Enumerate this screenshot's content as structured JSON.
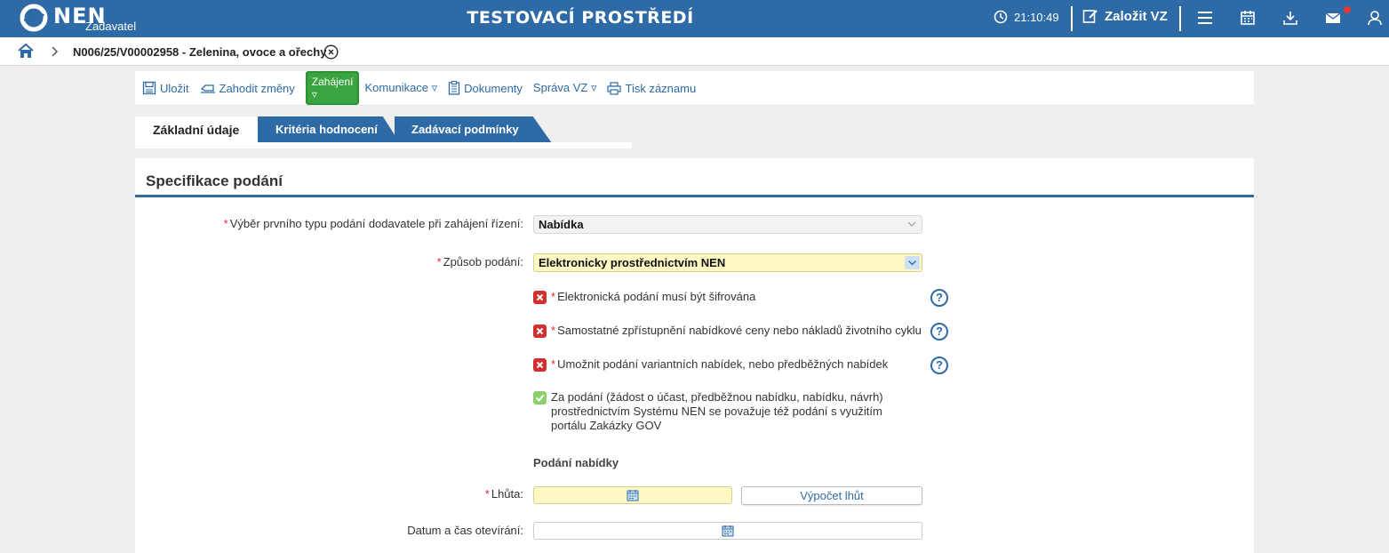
{
  "header": {
    "logo_text": "NEN",
    "logo_role": "Zadavatel",
    "environment_title": "TESTOVACÍ PROSTŘEDÍ",
    "time": "21:10:49",
    "create_label": "Založit VZ",
    "icons": [
      "clock-icon",
      "edit-icon",
      "menu-icon",
      "calendar-icon",
      "download-icon",
      "mail-icon",
      "user-icon"
    ],
    "notification_color": "#e53935",
    "brand_color": "#2e6aa6"
  },
  "breadcrumb": {
    "text": "N006/25/V00002958 - Zelenina, ovoce a ořechy"
  },
  "toolbar": {
    "save": "Uložit",
    "discard": "Zahodit změny",
    "start": "Zahájení ▿",
    "communication": "Komunikace ▿",
    "documents": "Dokumenty",
    "manage": "Správa VZ ▿",
    "print": "Tisk záznamu"
  },
  "tabs": [
    {
      "label": "Základní údaje",
      "active": true
    },
    {
      "label": "Kritéria hodnocení",
      "active": false
    },
    {
      "label": "Zadávací podmínky",
      "active": false
    }
  ],
  "panel": {
    "title": "Specifikace podání",
    "field_first_type": {
      "label": "Výběr prvního typu podání dodavatele při zahájení řízení:",
      "value": "Nabídka"
    },
    "field_method": {
      "label": "Způsob podání:",
      "value": "Elektronicky prostřednictvím NEN"
    },
    "checks": [
      {
        "label": "Elektronická podání musí být šifrována",
        "checked": false,
        "required": true
      },
      {
        "label": "Samostatné zpřístupnění nabídkové ceny nebo nákladů životního cyklu",
        "checked": false,
        "required": true
      },
      {
        "label": "Umožnit podání variantních nabídek, nebo předběžných nabídek",
        "checked": false,
        "required": true
      },
      {
        "label": "Za podání (žádost o účast, předběžnou nabídku, nabídku, návrh) prostřednictvím Systému NEN se považuje též podání s využitím portálu Zakázky GOV",
        "checked": true,
        "required": false
      }
    ],
    "help_symbol": "?",
    "subsection": "Podání nabídky",
    "deadline_label": "Lhůta:",
    "deadline_value": "",
    "calc_button": "Výpočet lhůt",
    "opening_label": "Datum a čas otevírání:",
    "opening_value": ""
  }
}
